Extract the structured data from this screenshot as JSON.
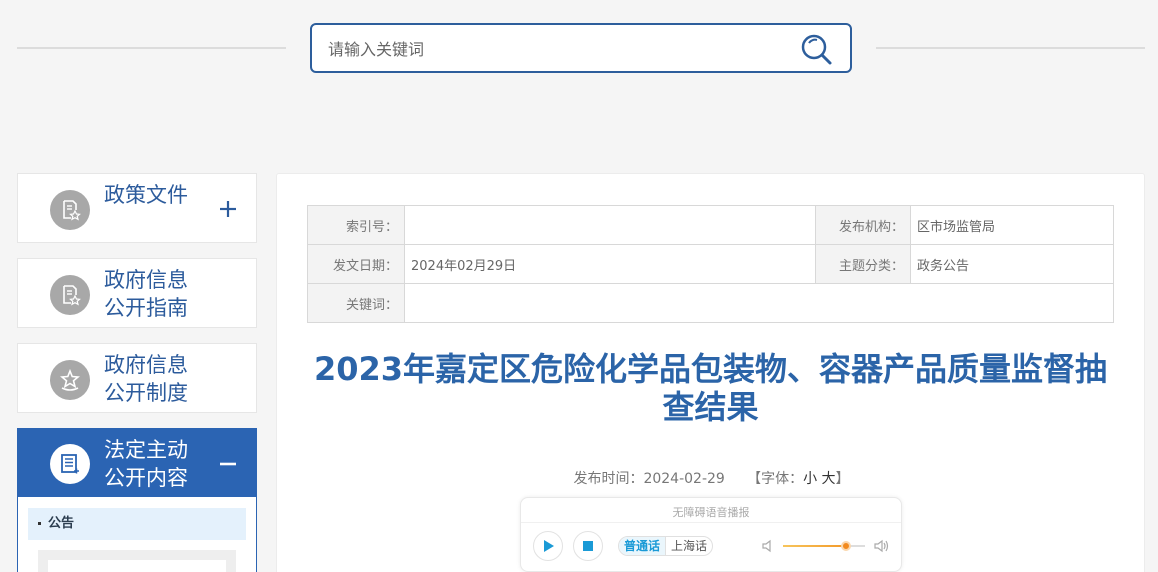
{
  "search": {
    "placeholder": "请输入关键词"
  },
  "sidebar": {
    "items": [
      {
        "label": "政策文件",
        "toggle": "plus"
      },
      {
        "label": "政府信息\n公开指南"
      },
      {
        "label": "政府信息\n公开制度"
      },
      {
        "label": "法定主动\n公开内容",
        "toggle": "minus",
        "active": true
      }
    ],
    "sub_items": [
      {
        "label": "公告"
      }
    ]
  },
  "meta": {
    "index_label": "索引号：",
    "index_value": "",
    "publisher_label": "发布机构：",
    "publisher_value": "区市场监管局",
    "date_label": "发文日期：",
    "date_value": "2024年02月29日",
    "category_label": "主题分类：",
    "category_value": "政务公告",
    "keywords_label": "关键词：",
    "keywords_value": ""
  },
  "article": {
    "title": "2023年嘉定区危险化学品包装物、容器产品质量监督抽查结果",
    "publish_label": "发布时间：",
    "publish_date": "2024-02-29",
    "font_label_open": "【字体：",
    "font_small": "小",
    "font_large": "大",
    "font_label_close": "】"
  },
  "audio": {
    "title": "无障碍语音播报",
    "dialect_selected": "普通话",
    "dialect_other": "上海话",
    "volume_level": 0.77
  },
  "colors": {
    "accent": "#2b64b3",
    "title": "#2b64a8",
    "slider": "#f28a1e",
    "play": "#1a9ad6"
  }
}
